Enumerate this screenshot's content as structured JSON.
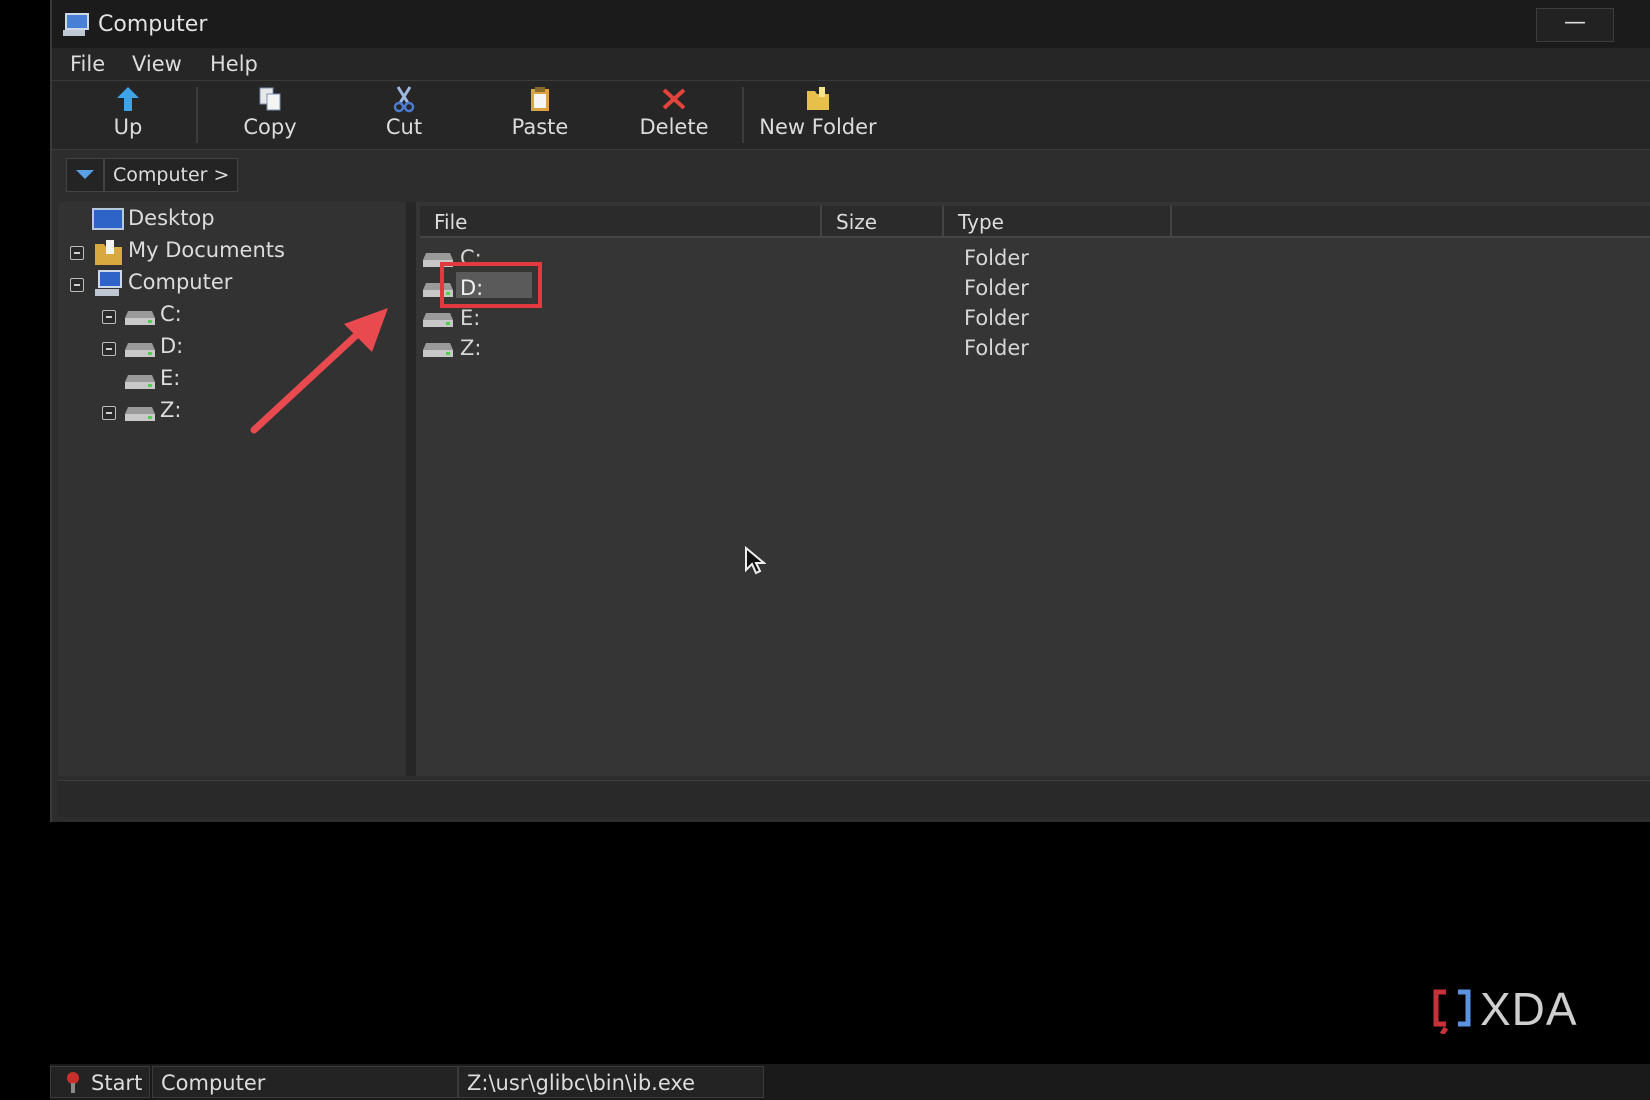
{
  "window": {
    "title": "Computer",
    "minimize_label": "—"
  },
  "menu": {
    "items": [
      "File",
      "View",
      "Help"
    ]
  },
  "toolbar": {
    "buttons": [
      {
        "label": "Up",
        "icon": "up-arrow-icon"
      },
      {
        "label": "Copy",
        "icon": "copy-icon"
      },
      {
        "label": "Cut",
        "icon": "scissors-icon"
      },
      {
        "label": "Paste",
        "icon": "paste-icon"
      },
      {
        "label": "Delete",
        "icon": "delete-x-icon"
      },
      {
        "label": "New Folder",
        "icon": "new-folder-icon"
      }
    ]
  },
  "address": {
    "crumb": "Computer >"
  },
  "tree": {
    "items": [
      {
        "label": "Desktop",
        "icon": "desktop-icon"
      },
      {
        "label": "My Documents",
        "icon": "documents-folder-icon"
      },
      {
        "label": "Computer",
        "icon": "computer-icon"
      },
      {
        "label": "C:",
        "icon": "drive-icon"
      },
      {
        "label": "D:",
        "icon": "drive-icon"
      },
      {
        "label": "E:",
        "icon": "drive-icon"
      },
      {
        "label": "Z:",
        "icon": "drive-icon"
      }
    ]
  },
  "list": {
    "columns": [
      "File",
      "Size",
      "Type"
    ],
    "rows": [
      {
        "file": "C:",
        "size": "",
        "type": "Folder"
      },
      {
        "file": "D:",
        "size": "",
        "type": "Folder",
        "selected": true
      },
      {
        "file": "E:",
        "size": "",
        "type": "Folder"
      },
      {
        "file": "Z:",
        "size": "",
        "type": "Folder"
      }
    ]
  },
  "taskbar": {
    "start_label": "Start",
    "tasks": [
      "Computer",
      "Z:\\usr\\glibc\\bin\\ib.exe"
    ]
  },
  "watermark": {
    "text": "XDA"
  },
  "colors": {
    "annotation_red": "#e03a3e",
    "window_bg": "#2d2d2d",
    "titlebar_bg": "#1b1b1b"
  }
}
